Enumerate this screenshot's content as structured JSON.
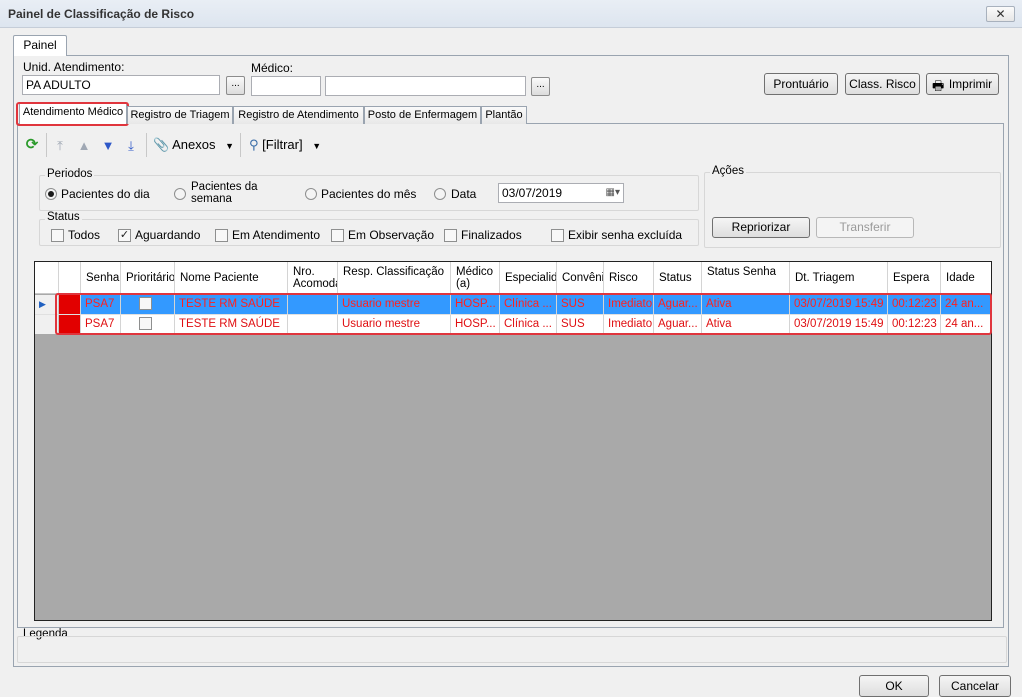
{
  "window": {
    "title": "Painel de Classificação de Risco",
    "close_label": "✕"
  },
  "outer_tab": {
    "label": "Painel"
  },
  "form": {
    "unid_label": "Unid. Atendimento:",
    "unid_value": "PA ADULTO",
    "medico_label": "Médico:",
    "medico_code": "",
    "medico_name": "",
    "dots": "..."
  },
  "top_buttons": {
    "prontuario": "Prontuário",
    "class_risco": "Class. Risco",
    "imprimir": "Imprimir"
  },
  "tabs": [
    {
      "label": "Atendimento Médico",
      "active": true
    },
    {
      "label": "Registro de Triagem"
    },
    {
      "label": "Registro de Atendimento"
    },
    {
      "label": "Posto de Enfermagem"
    },
    {
      "label": "Plantão"
    }
  ],
  "toolbar": {
    "anexos": "Anexos",
    "filtrar": "[Filtrar]"
  },
  "periodos": {
    "label": "Periodos",
    "options": [
      "Pacientes do dia",
      "Pacientes da semana",
      "Pacientes do mês",
      "Data"
    ],
    "selected": "Pacientes do dia",
    "date_value": "03/07/2019"
  },
  "status": {
    "label": "Status",
    "options": [
      {
        "label": "Todos",
        "checked": false
      },
      {
        "label": "Aguardando",
        "checked": true
      },
      {
        "label": "Em Atendimento",
        "checked": false
      },
      {
        "label": "Em Observação",
        "checked": false
      },
      {
        "label": "Finalizados",
        "checked": false
      },
      {
        "label": "Exibir senha excluída",
        "checked": false
      }
    ]
  },
  "acoes": {
    "label": "Ações",
    "repriorizar": "Repriorizar",
    "transferir": "Transferir"
  },
  "grid": {
    "columns": [
      "Senha",
      "Prioritário",
      "Nome Paciente",
      "Nro. Acomoda",
      "Resp. Classificação",
      "Médico (a)",
      "Especialida",
      "Convêni",
      "Risco",
      "Status",
      "Status Senha",
      "Dt. Triagem",
      "Espera",
      "Idade"
    ],
    "rows": [
      {
        "senha": "PSA7",
        "prioritario": false,
        "nome": "TESTE RM SAÚDE",
        "nro": "",
        "resp": "Usuario mestre",
        "medico": "HOSP...",
        "especialidade": "Clínica ...",
        "convenio": "SUS",
        "risco": "Imediato",
        "status": "Aguar...",
        "status_senha": "Ativa",
        "dt_triagem": "03/07/2019 15:49",
        "espera": "00:12:23",
        "idade": "24 an..."
      },
      {
        "senha": "PSA7",
        "prioritario": false,
        "nome": "TESTE RM SAÚDE",
        "nro": "",
        "resp": "Usuario mestre",
        "medico": "HOSP...",
        "especialidade": "Clínica ...",
        "convenio": "SUS",
        "risco": "Imediato",
        "status": "Aguar...",
        "status_senha": "Ativa",
        "dt_triagem": "03/07/2019 15:49",
        "espera": "00:12:23",
        "idade": "24 an..."
      }
    ]
  },
  "legenda": {
    "label": "Legenda"
  },
  "footer": {
    "ok": "OK",
    "cancelar": "Cancelar"
  },
  "colors": {
    "risk": "#e20000",
    "selection": "#3399ff",
    "highlight": "#e0353d"
  }
}
